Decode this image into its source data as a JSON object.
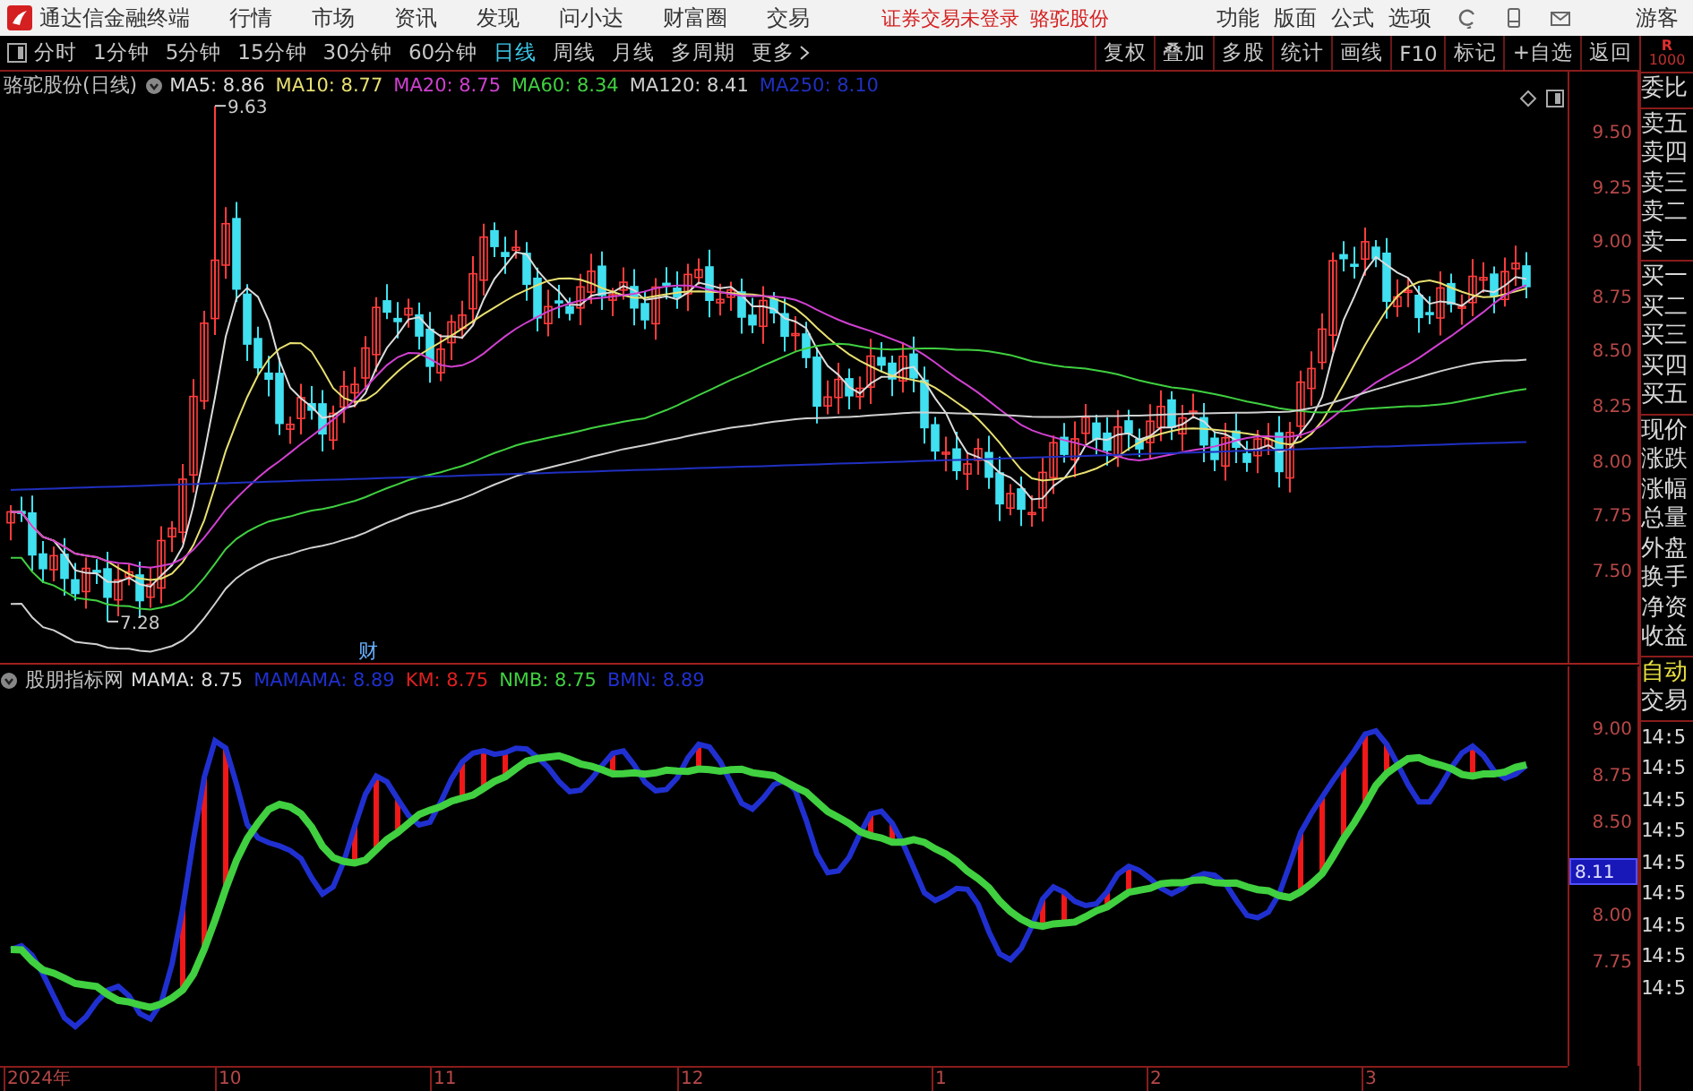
{
  "app": {
    "title": "通达信金融终端"
  },
  "menu": [
    "行情",
    "市场",
    "资讯",
    "发现",
    "问小达",
    "财富圈",
    "交易"
  ],
  "login_status": "证券交易未登录",
  "stock_name": "骆驼股份",
  "right_menu": [
    "功能",
    "版面",
    "公式",
    "选项"
  ],
  "user": "游客",
  "periods": [
    {
      "label": "分时",
      "selected": false
    },
    {
      "label": "1分钟",
      "selected": false
    },
    {
      "label": "5分钟",
      "selected": false
    },
    {
      "label": "15分钟",
      "selected": false
    },
    {
      "label": "30分钟",
      "selected": false
    },
    {
      "label": "60分钟",
      "selected": false
    },
    {
      "label": "日线",
      "selected": true
    },
    {
      "label": "周线",
      "selected": false
    },
    {
      "label": "月线",
      "selected": false
    },
    {
      "label": "多周期",
      "selected": false
    }
  ],
  "more": "更多",
  "tools": [
    "复权",
    "叠加",
    "多股",
    "统计",
    "画线",
    "F10",
    "标记",
    "+自选",
    "返回"
  ],
  "quote_badge": {
    "letter": "R",
    "value": "1000"
  },
  "price_chart": {
    "title": "骆驼股份(日线)",
    "legend": [
      {
        "label": "MA5: 8.86",
        "color": "#dcdcdc"
      },
      {
        "label": "MA10: 8.77",
        "color": "#e8e070"
      },
      {
        "label": "MA20: 8.75",
        "color": "#d040d0"
      },
      {
        "label": "MA60: 8.34",
        "color": "#40d040"
      },
      {
        "label": "MA120: 8.41",
        "color": "#d0d0d0"
      },
      {
        "label": "MA250: 8.10",
        "color": "#2030c0"
      }
    ],
    "high_label": "9.63",
    "low_label": "7.28",
    "event_marker": "财",
    "y_axis": [
      "9.50",
      "9.25",
      "9.00",
      "8.75",
      "8.50",
      "8.25",
      "8.00",
      "7.75",
      "7.50"
    ]
  },
  "indicator": {
    "title": "股朋指标网",
    "legend": [
      {
        "label": "MAMA: 8.75",
        "color": "#dcdcdc"
      },
      {
        "label": "MAMAMA: 8.89",
        "color": "#2030d0"
      },
      {
        "label": "KM: 8.75",
        "color": "#e02020"
      },
      {
        "label": "NMB: 8.75",
        "color": "#40d040"
      },
      {
        "label": "BMN: 8.89",
        "color": "#2030d0"
      }
    ],
    "y_axis": [
      {
        "label": "9.00",
        "kind": "tick"
      },
      {
        "label": "8.75",
        "kind": "tick"
      },
      {
        "label": "8.50",
        "kind": "tick"
      },
      {
        "label": "8.11",
        "kind": "cursor"
      },
      {
        "label": "8.00",
        "kind": "tick"
      },
      {
        "label": "7.75",
        "kind": "tick"
      }
    ]
  },
  "date_axis": [
    "2024年",
    "10",
    "11",
    "12",
    "1",
    "2",
    "3"
  ],
  "quote_panel": {
    "groups": [
      {
        "labels": [
          {
            "label": "委比",
            "kind": "normal"
          }
        ]
      },
      {
        "labels": [
          {
            "label": "卖五",
            "kind": "normal"
          },
          {
            "label": "卖四",
            "kind": "normal"
          },
          {
            "label": "卖三",
            "kind": "normal"
          },
          {
            "label": "卖二",
            "kind": "normal"
          },
          {
            "label": "卖一",
            "kind": "normal"
          }
        ]
      },
      {
        "labels": [
          {
            "label": "买一",
            "kind": "normal"
          },
          {
            "label": "买二",
            "kind": "normal"
          },
          {
            "label": "买三",
            "kind": "normal"
          },
          {
            "label": "买四",
            "kind": "normal"
          },
          {
            "label": "买五",
            "kind": "normal"
          }
        ]
      },
      {
        "labels": [
          {
            "label": "现价",
            "kind": "normal"
          },
          {
            "label": "涨跌",
            "kind": "normal"
          },
          {
            "label": "涨幅",
            "kind": "normal"
          },
          {
            "label": "总量",
            "kind": "normal"
          },
          {
            "label": "外盘",
            "kind": "normal"
          },
          {
            "label": "换手",
            "kind": "normal"
          },
          {
            "label": "净资",
            "kind": "normal"
          },
          {
            "label": "收益",
            "kind": "normal"
          }
        ]
      },
      {
        "labels": [
          {
            "label": "自动",
            "kind": "highlight"
          },
          {
            "label": "交易",
            "kind": "normal"
          }
        ]
      }
    ],
    "times": [
      "14:5",
      "14:5",
      "14:5",
      "14:5",
      "14:5",
      "14:5",
      "14:5",
      "14:5",
      "14:5"
    ]
  }
}
